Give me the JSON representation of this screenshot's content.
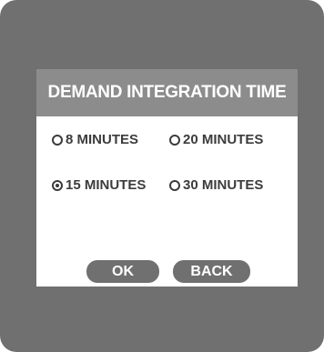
{
  "dialog": {
    "title": "DEMAND INTEGRATION TIME"
  },
  "options": [
    {
      "label": "8 MINUTES",
      "selected": false
    },
    {
      "label": "20 MINUTES",
      "selected": false
    },
    {
      "label": "15 MINUTES",
      "selected": true
    },
    {
      "label": "30 MINUTES",
      "selected": false
    }
  ],
  "buttons": {
    "ok_label": "OK",
    "back_label": "BACK"
  },
  "colors": {
    "device_bezel": "#707070",
    "title_bar": "#8c8c8c",
    "text": "#3c3c3c",
    "button": "#707070"
  }
}
